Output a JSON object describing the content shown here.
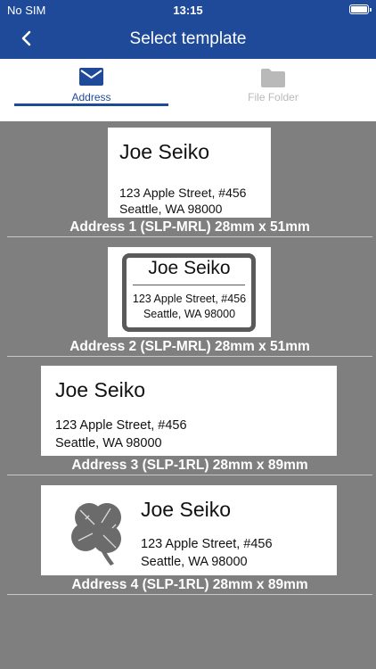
{
  "status_bar": {
    "carrier": "No SIM",
    "time": "13:15"
  },
  "nav": {
    "title": "Select template",
    "back_icon": "back-chevron-icon"
  },
  "tabs": [
    {
      "label": "Address",
      "icon": "envelope-icon",
      "selected": true
    },
    {
      "label": "File Folder",
      "icon": "folder-icon",
      "selected": false
    }
  ],
  "templates": [
    {
      "name": "Joe Seiko",
      "address_line1": "123 Apple Street, #456",
      "address_line2": "Seattle, WA 98000",
      "caption": "Address 1 (SLP-MRL) 28mm x 51mm",
      "style": "plain"
    },
    {
      "name": "Joe Seiko",
      "address_line1": "123 Apple Street, #456",
      "address_line2": "Seattle, WA 98000",
      "caption": "Address 2 (SLP-MRL) 28mm x 51mm",
      "style": "frame"
    },
    {
      "name": "Joe Seiko",
      "address_line1": "123 Apple Street, #456",
      "address_line2": "Seattle, WA 98000",
      "caption": "Address 3 (SLP-1RL) 28mm x 89mm",
      "style": "plain"
    },
    {
      "name": "Joe Seiko",
      "address_line1": "123 Apple Street, #456",
      "address_line2": "Seattle, WA 98000",
      "caption": "Address 4 (SLP-1RL) 28mm x 89mm",
      "style": "clover",
      "decoration_icon": "clover-icon"
    }
  ],
  "colors": {
    "nav_bar": "#1f4a9a",
    "list_background": "#7f7f7f",
    "tab_inactive": "#b9b9b9"
  }
}
